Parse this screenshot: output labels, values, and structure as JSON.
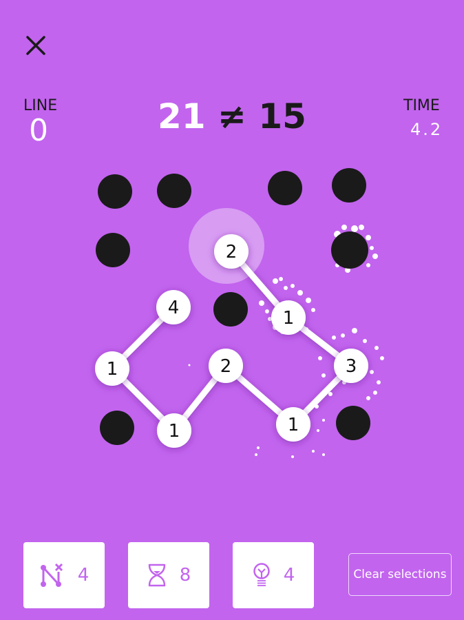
{
  "header": {
    "close_icon": "close-icon",
    "line_label": "LINE",
    "line_value": "0",
    "time_label": "TIME",
    "time_value": "4.2",
    "equation": {
      "left": "21",
      "operator": "≠",
      "right": "15"
    }
  },
  "board": {
    "colors": {
      "background": "#c264ee",
      "blocked": "#1a1a1a",
      "node": "#ffffff",
      "highlight": "#d89cf3"
    },
    "blocked_dots": [
      {
        "col": 0,
        "row": 0
      },
      {
        "col": 1,
        "row": 0
      },
      {
        "col": 3,
        "row": 0
      },
      {
        "col": 4,
        "row": 0
      },
      {
        "col": 0,
        "row": 1
      },
      {
        "col": 4,
        "row": 1
      },
      {
        "col": 2,
        "row": 2
      },
      {
        "col": 0,
        "row": 4
      },
      {
        "col": 4,
        "row": 4
      }
    ],
    "number_nodes": [
      {
        "id": "n2a",
        "value": "2",
        "selected": true
      },
      {
        "id": "n1a",
        "value": "1"
      },
      {
        "id": "n3",
        "value": "3"
      },
      {
        "id": "n1b",
        "value": "1"
      },
      {
        "id": "n2b",
        "value": "2"
      },
      {
        "id": "n1c",
        "value": "1"
      },
      {
        "id": "n1d",
        "value": "1"
      },
      {
        "id": "n4",
        "value": "4"
      }
    ],
    "path": [
      "n2a",
      "n1a",
      "n3",
      "n1b",
      "n2b",
      "n1c",
      "n1d",
      "n4"
    ]
  },
  "toolbar": {
    "tools": [
      {
        "name": "remove-link",
        "icon": "path-remove-icon",
        "count": "4"
      },
      {
        "name": "time",
        "icon": "hourglass-icon",
        "count": "8"
      },
      {
        "name": "hint",
        "icon": "lightbulb-icon",
        "count": "4"
      }
    ],
    "clear_label": "Clear selections"
  }
}
